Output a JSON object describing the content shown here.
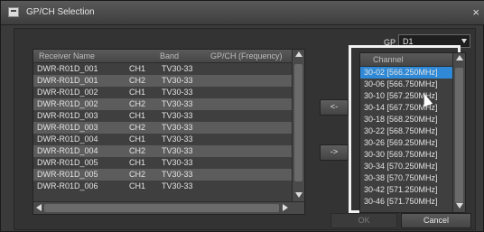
{
  "window": {
    "title": "GP/CH Selection",
    "close": "×"
  },
  "receiver_list": {
    "headers": [
      "Receiver Name",
      "Band",
      "GP/CH (Frequency)"
    ],
    "rows": [
      {
        "name": "DWR-R01D_001",
        "ch": "CH1",
        "band": "TV30-33",
        "freq": ""
      },
      {
        "name": "DWR-R01D_001",
        "ch": "CH2",
        "band": "TV30-33",
        "freq": ""
      },
      {
        "name": "DWR-R01D_002",
        "ch": "CH1",
        "band": "TV30-33",
        "freq": ""
      },
      {
        "name": "DWR-R01D_002",
        "ch": "CH2",
        "band": "TV30-33",
        "freq": ""
      },
      {
        "name": "DWR-R01D_003",
        "ch": "CH1",
        "band": "TV30-33",
        "freq": ""
      },
      {
        "name": "DWR-R01D_003",
        "ch": "CH2",
        "band": "TV30-33",
        "freq": ""
      },
      {
        "name": "DWR-R01D_004",
        "ch": "CH1",
        "band": "TV30-33",
        "freq": ""
      },
      {
        "name": "DWR-R01D_004",
        "ch": "CH2",
        "band": "TV30-33",
        "freq": ""
      },
      {
        "name": "DWR-R01D_005",
        "ch": "CH1",
        "band": "TV30-33",
        "freq": ""
      },
      {
        "name": "DWR-R01D_005",
        "ch": "CH2",
        "band": "TV30-33",
        "freq": ""
      },
      {
        "name": "DWR-R01D_006",
        "ch": "CH1",
        "band": "TV30-33",
        "freq": ""
      }
    ]
  },
  "buttons": {
    "move_left": "<-",
    "move_right": "->",
    "ok": "OK",
    "cancel": "Cancel"
  },
  "gp": {
    "label": "GP",
    "value": "D1"
  },
  "channel_list": {
    "header": "Channel",
    "items": [
      "30-02 [566.250MHz]",
      "30-06 [566.750MHz]",
      "30-10 [567.250MHz]",
      "30-14 [567.750MHz]",
      "30-18 [568.250MHz]",
      "30-22 [568.750MHz]",
      "30-26 [569.250MHz]",
      "30-30 [569.750MHz]",
      "30-34 [570.250MHz]",
      "30-38 [570.750MHz]",
      "30-42 [571.250MHz]",
      "30-46 [571.750MHz]"
    ]
  }
}
